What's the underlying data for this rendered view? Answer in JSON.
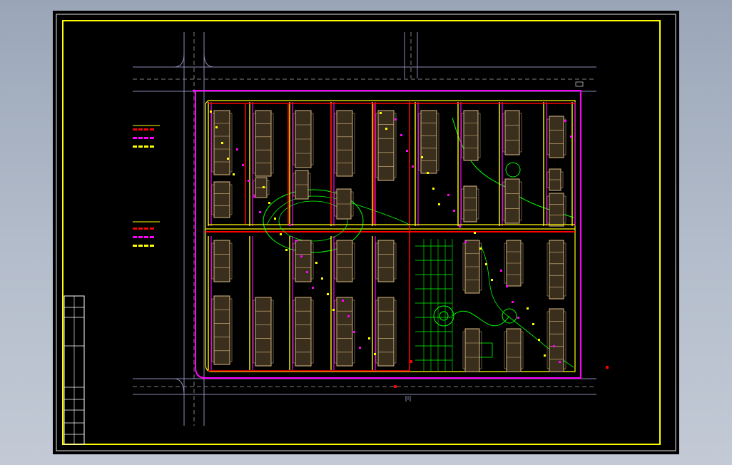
{
  "viewer": {
    "background": "#000000",
    "frame_color": "#ffff00"
  },
  "drawing": {
    "title_block": {
      "rows": 6,
      "label": "",
      "text": []
    },
    "colors": {
      "road": "#8a8ab4",
      "road_center": "#ffffff",
      "water_main": "#ff0000",
      "secondary": "#ff00ff",
      "branch": "#ffff00",
      "landscape": "#00ff00",
      "building_fill": "#3a2e1c",
      "building_outline": "#d9b983",
      "boundary": "#ff00ff"
    },
    "legend_blocks": [
      {
        "name": "legend-red",
        "color": "#ff0000"
      },
      {
        "name": "legend-magenta",
        "color": "#ff00ff"
      },
      {
        "name": "legend-yellow",
        "color": "#ffff00"
      }
    ]
  }
}
